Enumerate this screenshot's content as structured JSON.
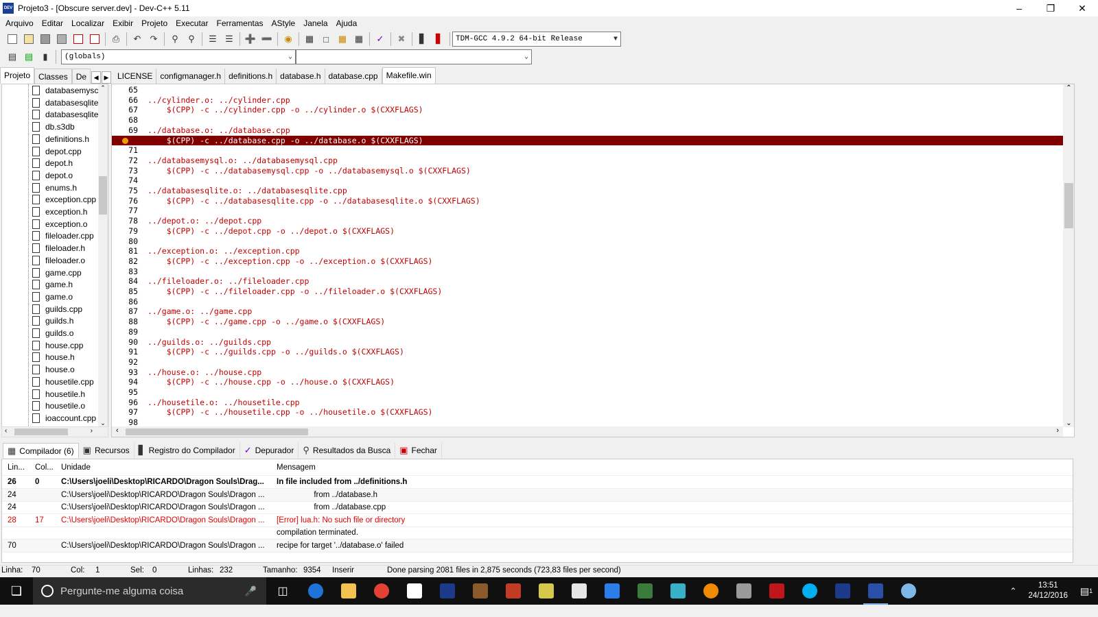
{
  "window": {
    "title": "Projeto3 - [Obscure server.dev] - Dev-C++ 5.11",
    "app_icon_text": "DEV"
  },
  "menu": [
    "Arquivo",
    "Editar",
    "Localizar",
    "Exibir",
    "Projeto",
    "Executar",
    "Ferramentas",
    "AStyle",
    "Janela",
    "Ajuda"
  ],
  "toolbar": {
    "compiler_select": "TDM-GCC 4.9.2 64-bit Release",
    "scope_select": "(globals)",
    "symbol_select": ""
  },
  "left_panel": {
    "tabs": [
      "Projeto",
      "Classes",
      "De"
    ],
    "files": [
      "databasemysc",
      "databasesqlite",
      "databasesqlite",
      "db.s3db",
      "definitions.h",
      "depot.cpp",
      "depot.h",
      "depot.o",
      "enums.h",
      "exception.cpp",
      "exception.h",
      "exception.o",
      "fileloader.cpp",
      "fileloader.h",
      "fileloader.o",
      "game.cpp",
      "game.h",
      "game.o",
      "guilds.cpp",
      "guilds.h",
      "guilds.o",
      "house.cpp",
      "house.h",
      "house.o",
      "housetile.cpp",
      "housetile.h",
      "housetile.o",
      "ioaccount.cpp"
    ]
  },
  "editor": {
    "tabs": [
      "LICENSE",
      "configmanager.h",
      "definitions.h",
      "database.h",
      "database.cpp",
      "Makefile.win"
    ],
    "active_tab": "Makefile.win",
    "lines": [
      {
        "n": "65",
        "code": ""
      },
      {
        "n": "66",
        "code": "../cylinder.o: ../cylinder.cpp"
      },
      {
        "n": "67",
        "code": "\t$(CPP) -c ../cylinder.cpp -o ../cylinder.o $(CXXFLAGS)"
      },
      {
        "n": "68",
        "code": ""
      },
      {
        "n": "69",
        "code": "../database.o: ../database.cpp"
      },
      {
        "n": "70",
        "code": "\t$(CPP) -c ../database.cpp -o ../database.o $(CXXFLAGS)",
        "highlight": true
      },
      {
        "n": "71",
        "code": ""
      },
      {
        "n": "72",
        "code": "../databasemysql.o: ../databasemysql.cpp"
      },
      {
        "n": "73",
        "code": "\t$(CPP) -c ../databasemysql.cpp -o ../databasemysql.o $(CXXFLAGS)"
      },
      {
        "n": "74",
        "code": ""
      },
      {
        "n": "75",
        "code": "../databasesqlite.o: ../databasesqlite.cpp"
      },
      {
        "n": "76",
        "code": "\t$(CPP) -c ../databasesqlite.cpp -o ../databasesqlite.o $(CXXFLAGS)"
      },
      {
        "n": "77",
        "code": ""
      },
      {
        "n": "78",
        "code": "../depot.o: ../depot.cpp"
      },
      {
        "n": "79",
        "code": "\t$(CPP) -c ../depot.cpp -o ../depot.o $(CXXFLAGS)"
      },
      {
        "n": "80",
        "code": ""
      },
      {
        "n": "81",
        "code": "../exception.o: ../exception.cpp"
      },
      {
        "n": "82",
        "code": "\t$(CPP) -c ../exception.cpp -o ../exception.o $(CXXFLAGS)"
      },
      {
        "n": "83",
        "code": ""
      },
      {
        "n": "84",
        "code": "../fileloader.o: ../fileloader.cpp"
      },
      {
        "n": "85",
        "code": "\t$(CPP) -c ../fileloader.cpp -o ../fileloader.o $(CXXFLAGS)"
      },
      {
        "n": "86",
        "code": ""
      },
      {
        "n": "87",
        "code": "../game.o: ../game.cpp"
      },
      {
        "n": "88",
        "code": "\t$(CPP) -c ../game.cpp -o ../game.o $(CXXFLAGS)"
      },
      {
        "n": "89",
        "code": ""
      },
      {
        "n": "90",
        "code": "../guilds.o: ../guilds.cpp"
      },
      {
        "n": "91",
        "code": "\t$(CPP) -c ../guilds.cpp -o ../guilds.o $(CXXFLAGS)"
      },
      {
        "n": "92",
        "code": ""
      },
      {
        "n": "93",
        "code": "../house.o: ../house.cpp"
      },
      {
        "n": "94",
        "code": "\t$(CPP) -c ../house.cpp -o ../house.o $(CXXFLAGS)"
      },
      {
        "n": "95",
        "code": ""
      },
      {
        "n": "96",
        "code": "../housetile.o: ../housetile.cpp"
      },
      {
        "n": "97",
        "code": "\t$(CPP) -c ../housetile.cpp -o ../housetile.o $(CXXFLAGS)"
      },
      {
        "n": "98",
        "code": ""
      }
    ]
  },
  "bottom_panel": {
    "tabs": [
      {
        "label": "Compilador (6)",
        "icon": "compiler-icon"
      },
      {
        "label": "Recursos",
        "icon": "resources-icon"
      },
      {
        "label": "Registro do Compilador",
        "icon": "compile-log-icon"
      },
      {
        "label": "Depurador",
        "icon": "debugger-icon"
      },
      {
        "label": "Resultados da Busca",
        "icon": "search-results-icon"
      },
      {
        "label": "Fechar",
        "icon": "close-panel-icon"
      }
    ],
    "columns": [
      "Lin...",
      "Col...",
      "Unidade",
      "Mensagem"
    ],
    "rows": [
      {
        "line": "26",
        "col": "0",
        "unit": "C:\\Users\\joeli\\Desktop\\RICARDO\\Dragon Souls\\Drag...",
        "message": "In file included from ../definitions.h",
        "style": "bold"
      },
      {
        "line": "24",
        "col": "",
        "unit": "C:\\Users\\joeli\\Desktop\\RICARDO\\Dragon Souls\\Dragon ...",
        "message": "                 from ../database.h",
        "style": ""
      },
      {
        "line": "24",
        "col": "",
        "unit": "C:\\Users\\joeli\\Desktop\\RICARDO\\Dragon Souls\\Dragon ...",
        "message": "                 from ../database.cpp",
        "style": ""
      },
      {
        "line": "28",
        "col": "17",
        "unit": "C:\\Users\\joeli\\Desktop\\RICARDO\\Dragon Souls\\Dragon ...",
        "message": "[Error] lua.h: No such file or directory",
        "style": "err"
      },
      {
        "line": "",
        "col": "",
        "unit": "",
        "message": "compilation terminated.",
        "style": ""
      },
      {
        "line": "70",
        "col": "",
        "unit": "C:\\Users\\joeli\\Desktop\\RICARDO\\Dragon Souls\\Dragon ...",
        "message": "recipe for target '../database.o' failed",
        "style": ""
      }
    ]
  },
  "status": {
    "linha_label": "Linha:",
    "linha": "70",
    "col_label": "Col:",
    "col": "1",
    "sel_label": "Sel:",
    "sel": "0",
    "linhas_label": "Linhas:",
    "linhas": "232",
    "tamanho_label": "Tamanho:",
    "tamanho": "9354",
    "mode": "Inserir",
    "message": "Done parsing 2081 files in 2,875 seconds (723,83 files per second)"
  },
  "taskbar": {
    "search_placeholder": "Pergunte-me alguma coisa",
    "time": "13:51",
    "date": "24/12/2016",
    "notification_count": "1"
  },
  "colors": {
    "error_line_bg": "#800000",
    "code_text": "#c00000",
    "error_text": "#e00000",
    "taskbar": "#101010"
  }
}
